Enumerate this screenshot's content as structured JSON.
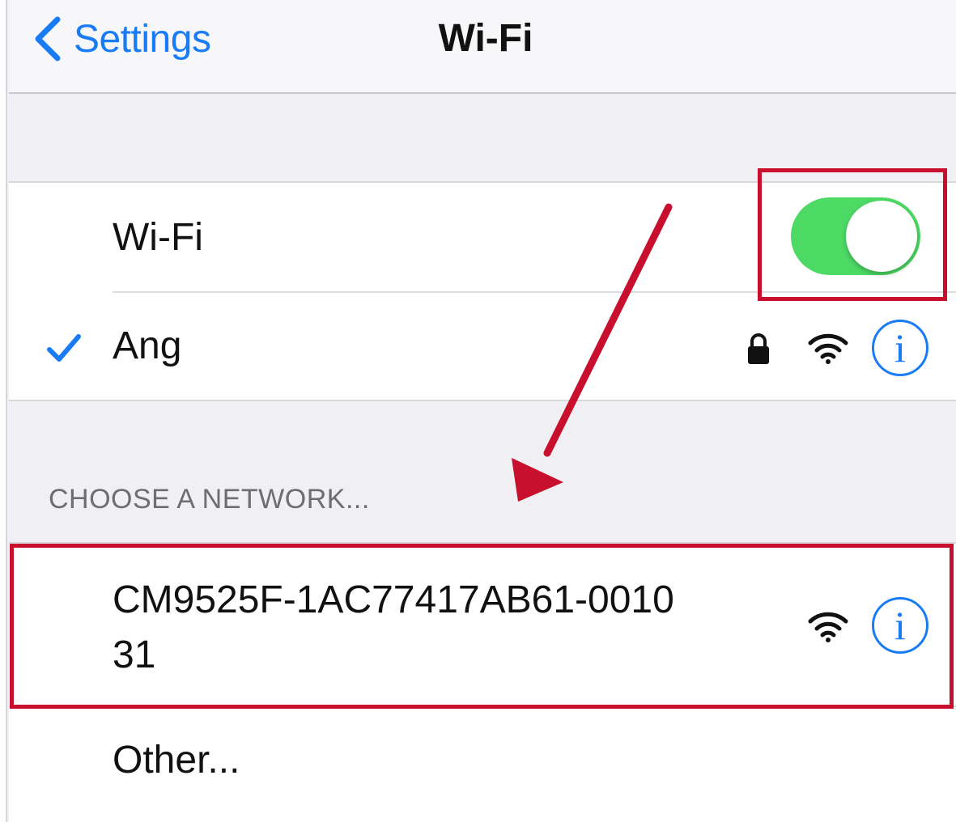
{
  "nav": {
    "back_label": "Settings",
    "back_icon": "chevron-left-icon",
    "title": "Wi-Fi"
  },
  "wifi_toggle": {
    "label": "Wi-Fi",
    "state": "on",
    "on_color": "#4cd964"
  },
  "connected_network": {
    "name": "Ang",
    "checked": true,
    "secured": true,
    "icons": [
      "checkmark-icon",
      "lock-icon",
      "wifi-signal-icon",
      "info-icon"
    ]
  },
  "section_header": "CHOOSE A NETWORK...",
  "networks": [
    {
      "name_line1": "CM9525F-1AC77417AB61-0010",
      "name_line2": "31",
      "icons": [
        "wifi-signal-icon",
        "info-icon"
      ]
    }
  ],
  "other_label": "Other...",
  "info_glyph": "i",
  "colors": {
    "accent": "#1a7cf5",
    "toggle_on": "#4cd964",
    "annotation": "#c8102e"
  }
}
